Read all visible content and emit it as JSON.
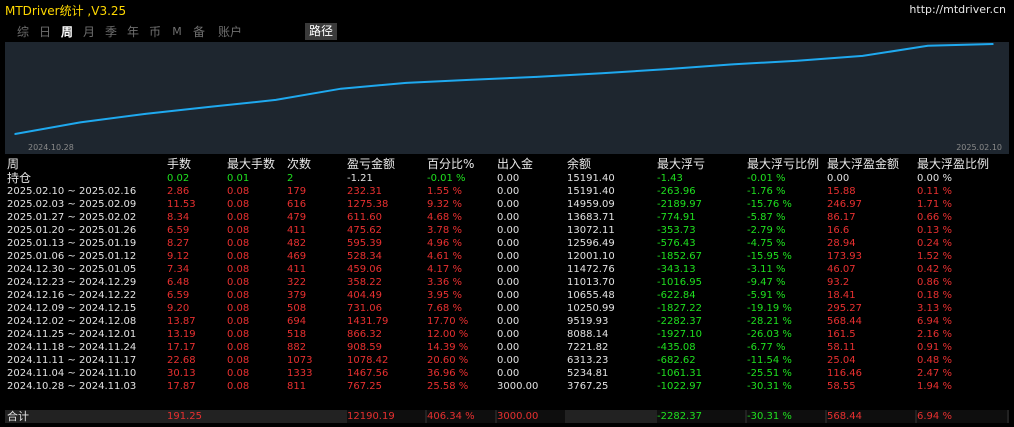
{
  "window": {
    "title": "MTDriver统计 ,V3.25",
    "url": "http://mtdriver.cn"
  },
  "tabs": [
    {
      "label": "综",
      "active": false
    },
    {
      "label": "日",
      "active": false
    },
    {
      "label": "周",
      "active": true
    },
    {
      "label": "月",
      "active": false
    },
    {
      "label": "季",
      "active": false
    },
    {
      "label": "年",
      "active": false
    },
    {
      "label": "币",
      "active": false
    },
    {
      "label": "M",
      "active": false
    },
    {
      "label": "备",
      "active": false
    },
    {
      "label": "账户",
      "active": false
    }
  ],
  "path_button": "路径",
  "chart_data": {
    "type": "line",
    "x_start_label": "2024.10.28",
    "x_end_label": "2025.02.10",
    "x": [
      "2024.10.28",
      "2024.11.04",
      "2024.11.11",
      "2024.11.18",
      "2024.11.25",
      "2024.12.02",
      "2024.12.09",
      "2024.12.16",
      "2024.12.23",
      "2024.12.30",
      "2025.01.06",
      "2025.01.13",
      "2025.01.20",
      "2025.01.27",
      "2025.02.03",
      "2025.02.10"
    ],
    "values": [
      767.25,
      2234.81,
      3313.23,
      4221.82,
      5088.14,
      6519.93,
      7250.99,
      7655.48,
      8013.7,
      8472.76,
      9001.1,
      9596.49,
      10072.11,
      10683.71,
      11959.09,
      12191.4
    ],
    "color": "#1fa9ef",
    "fill": "#1e262f"
  },
  "table": {
    "headers": [
      "周",
      "手数",
      "最大手数",
      "次数",
      "盈亏金额",
      "百分比%",
      "出入金",
      "余额",
      "最大浮亏",
      "最大浮亏比例",
      "最大浮盈金额",
      "最大浮盈比例"
    ],
    "open_position": {
      "label": "持仓",
      "cells": [
        "0.02",
        "0.01",
        "2",
        "-1.21",
        "-0.01 %",
        "0.00",
        "15191.40",
        "-1.43",
        "-0.01 %",
        "0.00",
        "0.00 %"
      ],
      "colors": [
        "green",
        "green",
        "green",
        "white",
        "green",
        "white",
        "white",
        "green",
        "green",
        "white",
        "white"
      ]
    },
    "rows": [
      {
        "period": "2025.02.10 ~ 2025.02.16",
        "cells": [
          "2.86",
          "0.08",
          "179",
          "232.31",
          "1.55 %",
          "0.00",
          "15191.40",
          "-263.96",
          "-1.76 %",
          "15.88",
          "0.11 %"
        ]
      },
      {
        "period": "2025.02.03 ~ 2025.02.09",
        "cells": [
          "11.53",
          "0.08",
          "616",
          "1275.38",
          "9.32 %",
          "0.00",
          "14959.09",
          "-2189.97",
          "-15.76 %",
          "246.97",
          "1.71 %"
        ]
      },
      {
        "period": "2025.01.27 ~ 2025.02.02",
        "cells": [
          "8.34",
          "0.08",
          "479",
          "611.60",
          "4.68 %",
          "0.00",
          "13683.71",
          "-774.91",
          "-5.87 %",
          "86.17",
          "0.66 %"
        ]
      },
      {
        "period": "2025.01.20 ~ 2025.01.26",
        "cells": [
          "6.59",
          "0.08",
          "411",
          "475.62",
          "3.78 %",
          "0.00",
          "13072.11",
          "-353.73",
          "-2.79 %",
          "16.6",
          "0.13 %"
        ]
      },
      {
        "period": "2025.01.13 ~ 2025.01.19",
        "cells": [
          "8.27",
          "0.08",
          "482",
          "595.39",
          "4.96 %",
          "0.00",
          "12596.49",
          "-576.43",
          "-4.75 %",
          "28.94",
          "0.24 %"
        ]
      },
      {
        "period": "2025.01.06 ~ 2025.01.12",
        "cells": [
          "9.12",
          "0.08",
          "469",
          "528.34",
          "4.61 %",
          "0.00",
          "12001.10",
          "-1852.67",
          "-15.95 %",
          "173.93",
          "1.52 %"
        ]
      },
      {
        "period": "2024.12.30 ~ 2025.01.05",
        "cells": [
          "7.34",
          "0.08",
          "411",
          "459.06",
          "4.17 %",
          "0.00",
          "11472.76",
          "-343.13",
          "-3.11 %",
          "46.07",
          "0.42 %"
        ]
      },
      {
        "period": "2024.12.23 ~ 2024.12.29",
        "cells": [
          "6.48",
          "0.08",
          "322",
          "358.22",
          "3.36 %",
          "0.00",
          "11013.70",
          "-1016.95",
          "-9.47 %",
          "93.2",
          "0.86 %"
        ]
      },
      {
        "period": "2024.12.16 ~ 2024.12.22",
        "cells": [
          "6.59",
          "0.08",
          "379",
          "404.49",
          "3.95 %",
          "0.00",
          "10655.48",
          "-622.84",
          "-5.91 %",
          "18.41",
          "0.18 %"
        ]
      },
      {
        "period": "2024.12.09 ~ 2024.12.15",
        "cells": [
          "9.20",
          "0.08",
          "508",
          "731.06",
          "7.68 %",
          "0.00",
          "10250.99",
          "-1827.22",
          "-19.19 %",
          "295.27",
          "3.13 %"
        ]
      },
      {
        "period": "2024.12.02 ~ 2024.12.08",
        "cells": [
          "13.87",
          "0.08",
          "694",
          "1431.79",
          "17.70 %",
          "0.00",
          "9519.93",
          "-2282.37",
          "-28.21 %",
          "568.44",
          "6.94 %"
        ]
      },
      {
        "period": "2024.11.25 ~ 2024.12.01",
        "cells": [
          "13.19",
          "0.08",
          "518",
          "866.32",
          "12.00 %",
          "0.00",
          "8088.14",
          "-1927.10",
          "-26.03 %",
          "161.5",
          "2.16 %"
        ]
      },
      {
        "period": "2024.11.18 ~ 2024.11.24",
        "cells": [
          "17.17",
          "0.08",
          "882",
          "908.59",
          "14.39 %",
          "0.00",
          "7221.82",
          "-435.08",
          "-6.77 %",
          "58.11",
          "0.91 %"
        ]
      },
      {
        "period": "2024.11.11 ~ 2024.11.17",
        "cells": [
          "22.68",
          "0.08",
          "1073",
          "1078.42",
          "20.60 %",
          "0.00",
          "6313.23",
          "-682.62",
          "-11.54 %",
          "25.04",
          "0.48 %"
        ]
      },
      {
        "period": "2024.11.04 ~ 2024.11.10",
        "cells": [
          "30.13",
          "0.08",
          "1333",
          "1467.56",
          "36.96 %",
          "0.00",
          "5234.81",
          "-1061.31",
          "-25.51 %",
          "116.46",
          "2.47 %"
        ]
      },
      {
        "period": "2024.10.28 ~ 2024.11.03",
        "cells": [
          "17.87",
          "0.08",
          "811",
          "767.25",
          "25.58 %",
          "3000.00",
          "3767.25",
          "-1022.97",
          "-30.31 %",
          "58.55",
          "1.94 %"
        ]
      }
    ],
    "row_colors": [
      "red",
      "red",
      "red",
      "red",
      "red",
      "white",
      "white",
      "green",
      "green",
      "red",
      "red"
    ],
    "total": {
      "label": "合计",
      "cells": [
        "191.25",
        "",
        "",
        "12190.19",
        "406.34 %",
        "3000.00",
        "",
        "-2282.37",
        "-30.31 %",
        "568.44",
        "6.94 %"
      ],
      "colors": [
        "red",
        "red",
        "red",
        "red",
        "red",
        "red",
        "white",
        "green",
        "green",
        "red",
        "red"
      ]
    }
  }
}
